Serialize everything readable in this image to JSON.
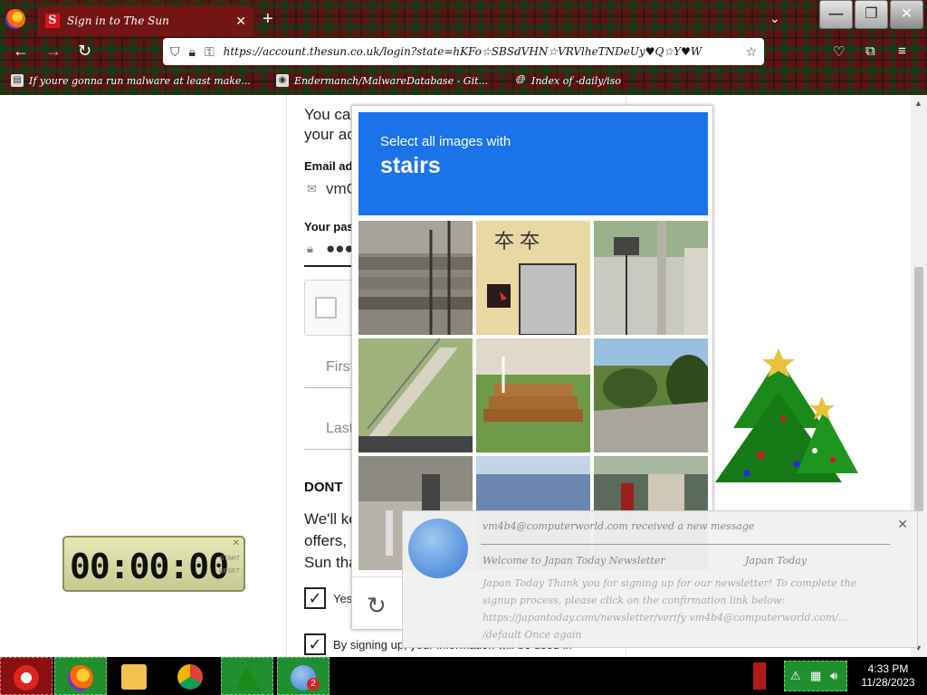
{
  "browser": {
    "tab_title": "Sign in to The Sun",
    "tab_favicon": "S",
    "url": "https://account.thesun.co.uk/login?state=hKFo☆SBSdVHN☆VRVlheTNDeUy♥Q☆Y♥W",
    "bookmarks": [
      {
        "icon": "book-icon",
        "label": "If youre gonna run malware at least make..."
      },
      {
        "icon": "github-icon",
        "label": "Endermanch/MalwareDatabase - Git..."
      },
      {
        "icon": "globe-icon",
        "label": "Index of -daily/iso"
      }
    ]
  },
  "form": {
    "intro_l1": "You can",
    "intro_l2": "your acc",
    "email_label": "Email ad",
    "email_value": "vmC",
    "password_label": "Your pas",
    "password_value": "●●●",
    "first_placeholder": "First",
    "last_placeholder": "Last",
    "dont_heading": "DONT",
    "body_l1": "We'll ke",
    "body_l2": "offers,",
    "body_l3": "Sun tha",
    "yes_label": "Yes",
    "consent_label": "By signing up, your information will be used in",
    "checkmark": "✓"
  },
  "captcha": {
    "prompt": "Select all images with",
    "target": "stairs",
    "reload_icon": "↻"
  },
  "countdown": {
    "display": "00:00:00",
    "side_a": "START",
    "side_b": "RESET"
  },
  "notification": {
    "header": "vm4b4@computerworld.com received a new message",
    "subject": "Welcome to Japan Today Newsletter",
    "sender": "Japan Today",
    "body": "Japan Today Thank you for signing up for our newsletter! To complete the signup process, please click on the confirmation link below: https://japantoday.com/newsletter/verify vm4b4@computerworld.com/... /default Once again"
  },
  "taskbar": {
    "time": "4:33 PM",
    "date": "11/28/2023",
    "badge": "2"
  }
}
